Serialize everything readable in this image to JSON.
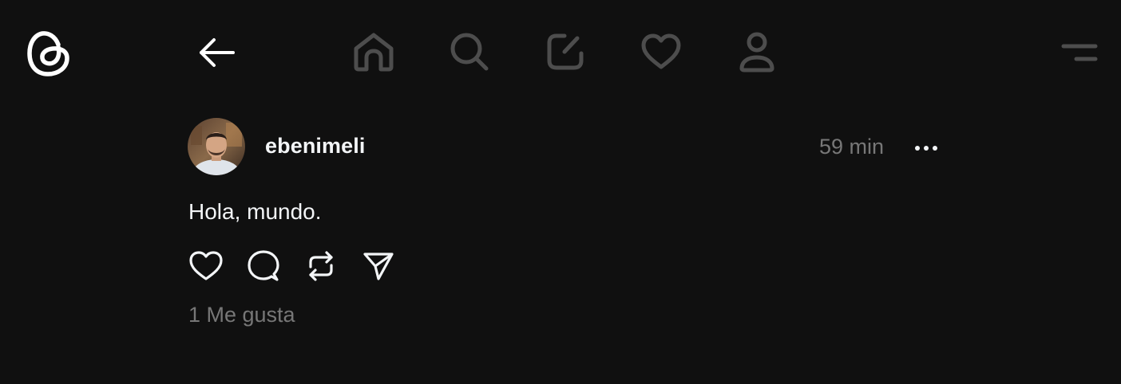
{
  "app": {
    "logo_icon": "threads-logo-icon",
    "background_color": "#101010"
  },
  "topbar": {
    "back_icon": "arrow-left-icon",
    "nav": [
      {
        "icon": "home-icon"
      },
      {
        "icon": "search-icon"
      },
      {
        "icon": "compose-icon"
      },
      {
        "icon": "heart-icon"
      },
      {
        "icon": "profile-icon"
      }
    ],
    "menu_icon": "hamburger-menu-icon",
    "inactive_icon_color": "#4d4d4d"
  },
  "post": {
    "username": "ebenimeli",
    "timestamp": "59 min",
    "more_icon": "more-dots-icon",
    "text": "Hola, mundo.",
    "actions": [
      {
        "icon": "like-icon"
      },
      {
        "icon": "reply-icon"
      },
      {
        "icon": "repost-icon"
      },
      {
        "icon": "share-icon"
      }
    ],
    "likes_label": "1 Me gusta"
  },
  "colors": {
    "primary_text": "#f3f5f7",
    "secondary_text": "#777777"
  }
}
